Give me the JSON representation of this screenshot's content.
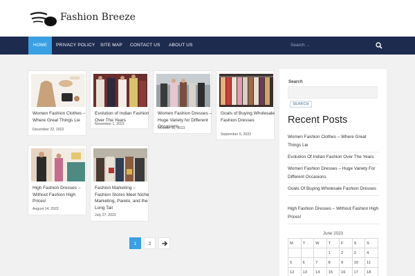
{
  "site": {
    "title": "Fashion Breeze"
  },
  "nav": {
    "items": [
      {
        "label": "Home",
        "active": true
      },
      {
        "label": "Privacy Policy",
        "active": false
      },
      {
        "label": "Site Map",
        "active": false
      },
      {
        "label": "Contact Us",
        "active": false
      },
      {
        "label": "About Us",
        "active": false
      }
    ],
    "search_placeholder": "Search ..."
  },
  "posts": [
    {
      "title": "Women Fashion Clothes – Where Great Things Lie",
      "date": "December 22, 2022"
    },
    {
      "title": "Evolution of Indian Fashion Over The Years",
      "date": "November 1, 2022"
    },
    {
      "title": "Women Fashion Dresses – Huge Variety for Different Occasions",
      "date": "October 11, 2022"
    },
    {
      "title": "Goals of Buying Wholesale Fashion Dresses",
      "date": "September 6, 2022"
    },
    {
      "title": "High Fashion Dresses – Without Fashion High Prices!",
      "date": "August 14, 2022"
    },
    {
      "title": "Fashion Marketing – Fashion Stores Meet Niche Marketing, Pareto, and the Long Tail",
      "date": "July 27, 2022"
    }
  ],
  "pagination": {
    "pages": [
      "1",
      "2"
    ],
    "next_icon": "arrow-right-icon",
    "current": "1"
  },
  "sidebar": {
    "search_label": "Search",
    "search_button": "SEARCH",
    "recent_heading": "Recent Posts",
    "recent_posts": [
      "Women Fashion Clothes – Where Great Things Lie",
      "Evolution Of Indian Fashion Over The Years",
      "Women Fashion Dresses – Huge Variety For Different Occasions",
      "Goals Of Buying Wholesale Fashion Dresses",
      "High Fashion Dresses – Without Fashion High Prices!"
    ],
    "calendar": {
      "caption": "June 2023",
      "weekdays": [
        "M",
        "T",
        "W",
        "T",
        "F",
        "S",
        "S"
      ],
      "rows": [
        [
          "",
          "",
          "",
          "1",
          "2",
          "3",
          "4"
        ],
        [
          "5",
          "6",
          "7",
          "8",
          "9",
          "10",
          "11"
        ],
        [
          "12",
          "13",
          "14",
          "15",
          "16",
          "17",
          "18"
        ]
      ]
    }
  },
  "colors": {
    "nav_bg": "#1d2b4f",
    "accent": "#3aa0e4",
    "page_bg": "#f1f1f1"
  }
}
